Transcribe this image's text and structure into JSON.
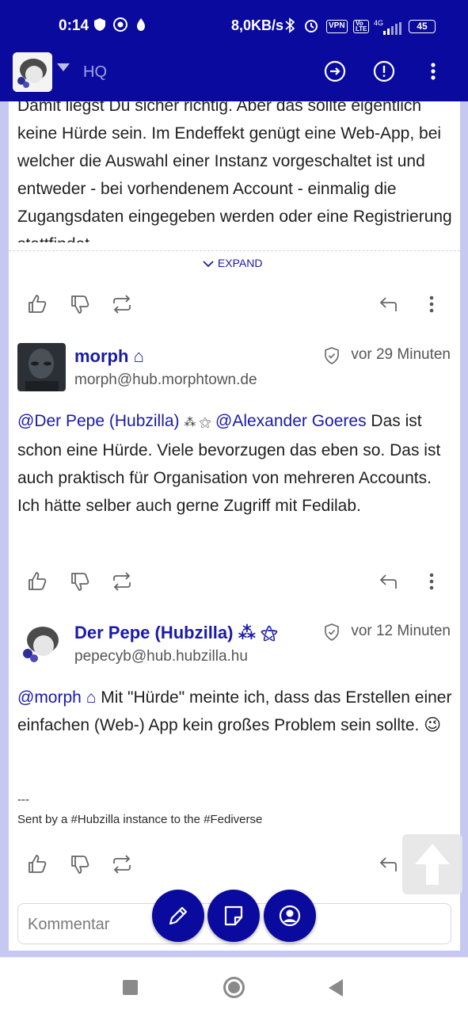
{
  "status_bar": {
    "time": "0:14",
    "network_speed": "8,0KB/s",
    "vpn": "VPN",
    "volte": "Vo LTE",
    "signal": "4G",
    "battery": "45"
  },
  "app_bar": {
    "title": "HQ",
    "actions": [
      "arrow-right-circle-icon",
      "alert-circle-icon",
      "more-vert-icon"
    ]
  },
  "posts": [
    {
      "text": "Damit liegst Du sicher richtig. Aber das sollte eigentlich keine Hürde sein. Im Endeffekt genügt eine Web-App, bei welcher die Auswahl einer Instanz vorgeschaltet ist und entweder - bei vorhendenem Account - einmalig die Zugangsdaten eingegeben werden oder eine Registrierung stattfindet.",
      "expand_label": "EXPAND"
    },
    {
      "author_name": "morph",
      "author_badge": "⌂",
      "address": "morph@hub.morphtown.de",
      "time": "vor 29 Minuten",
      "mention1": "@Der Pepe (Hubzilla)",
      "mention1_badge": "⁂ ⚝",
      "mention2": "@Alexander Goeres",
      "text": " Das ist schon eine Hürde. Viele bevorzugen das eben so. Das ist auch praktisch für Organisation von mehreren Accounts. Ich hätte selber auch gerne Zugriff mit Fedilab."
    },
    {
      "author_name": "Der Pepe (Hubzilla)",
      "author_badge": "⁂ ⚝",
      "address": "pepecyb@hub.hubzilla.hu",
      "time": "vor 12 Minuten",
      "mention1": "@morph",
      "mention1_badge": "⌂",
      "text": " Mit \"Hürde\" meinte ich, dass das Erstellen einer einfachen (Web-) App kein großes Problem sein sollte. 😉",
      "sig_line": "---",
      "sig_text": "Sent by a #Hubzilla instance to the #Fediverse"
    }
  ],
  "comment": {
    "placeholder": "Kommentar"
  },
  "colors": {
    "primary": "#0a0a9e",
    "link": "#1a1aa8",
    "background": "#c6c8f2"
  }
}
